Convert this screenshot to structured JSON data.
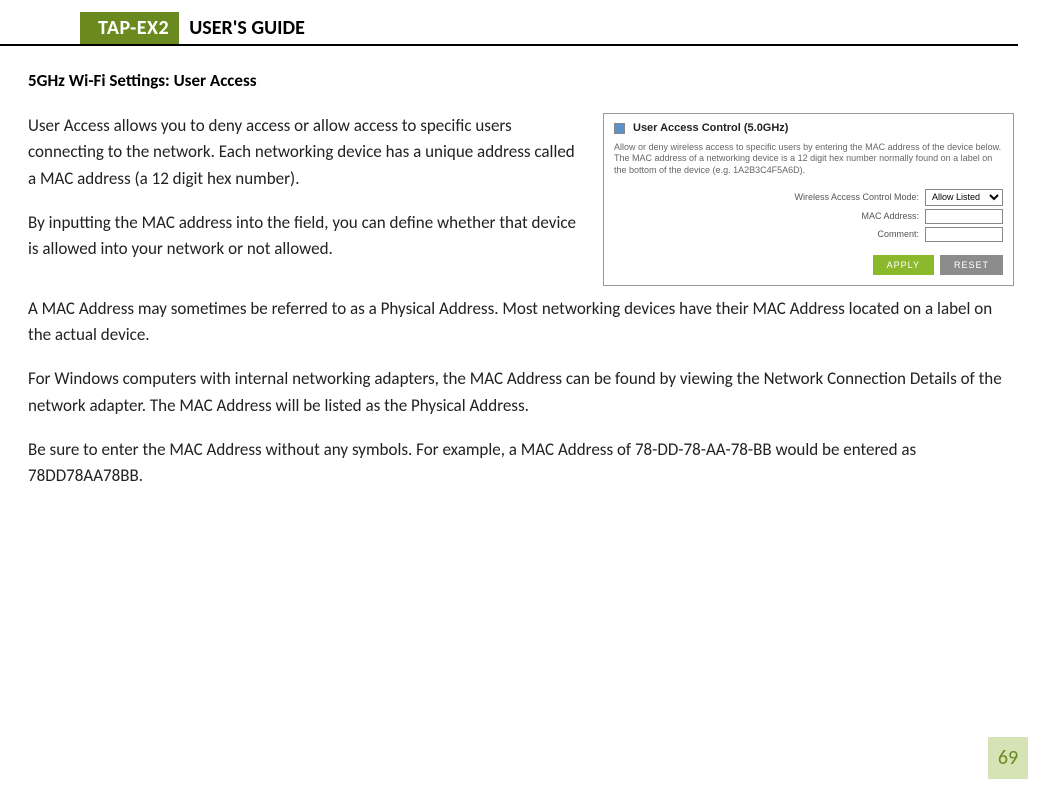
{
  "header": {
    "product": "TAP-EX2",
    "guide": "USER'S GUIDE"
  },
  "section_heading": "5GHz Wi-Fi Settings: User Access",
  "paragraphs": {
    "p1": "User Access allows you to deny access or allow access to specific users connecting to the network. Each networking device has a unique address called a MAC address (a 12 digit hex number).",
    "p2": "By inputting the MAC address into the field, you can define whether that device is allowed into your network or not allowed.",
    "p3": "A MAC Address may sometimes be referred to as a Physical Address. Most networking devices have their MAC Address located on a label on the actual device.",
    "p4": "For Windows computers with internal networking adapters, the MAC Address can be found by viewing the Network Connection Details of the network adapter. The MAC Address will be listed as the Physical Address.",
    "p5": "Be sure to enter the MAC Address without any symbols. For example, a MAC Address of 78-DD-78-AA-78-BB would be entered as 78DD78AA78BB."
  },
  "figure": {
    "title": "User Access Control (5.0GHz)",
    "description": "Allow or deny wireless access to specific users by entering the MAC address of the device below. The MAC address of a networking device is a 12 digit hex number normally found on a label on the bottom of the device (e.g. 1A2B3C4F5A6D).",
    "labels": {
      "mode": "Wireless Access Control Mode:",
      "mac": "MAC Address:",
      "comment": "Comment:"
    },
    "mode_value": "Allow Listed",
    "buttons": {
      "apply": "APPLY",
      "reset": "RESET"
    }
  },
  "page_number": "69"
}
